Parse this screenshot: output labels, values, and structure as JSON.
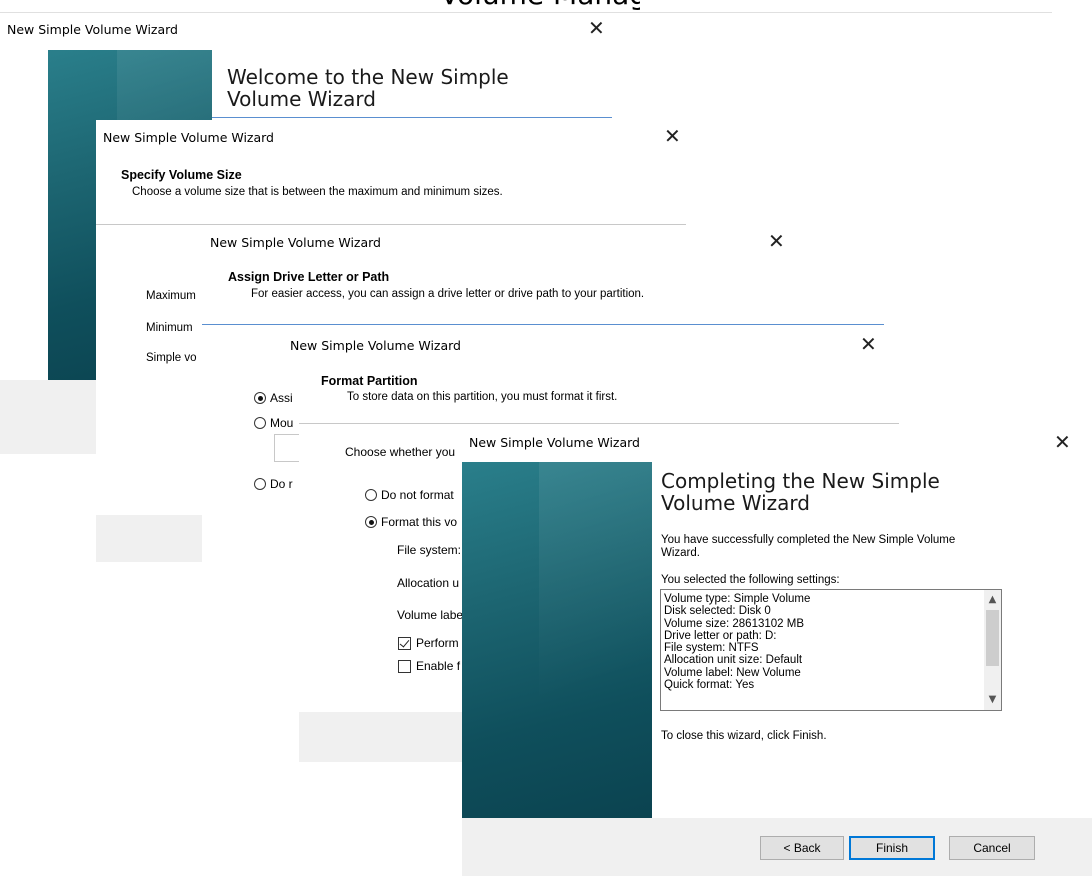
{
  "top_fragment": "Volume Management",
  "w1": {
    "title": "New Simple Volume Wizard",
    "heading_line1": "Welcome to the New Simple",
    "heading_line2": "Volume Wizard"
  },
  "w2": {
    "title": "New Simple Volume Wizard",
    "heading": "Specify Volume Size",
    "subtitle": "Choose a volume size that is between the maximum and minimum sizes.",
    "label_max": "Maximum",
    "label_min": "Minimum",
    "label_simple": "Simple vo"
  },
  "w3": {
    "title": "New Simple Volume Wizard",
    "heading": "Assign Drive Letter or Path",
    "subtitle": "For easier access, you can assign a drive letter or drive path to your partition.",
    "opt_assign": "Assi",
    "opt_mount": "Mou",
    "opt_none": "Do r"
  },
  "w4": {
    "title": "New Simple Volume Wizard",
    "heading": "Format Partition",
    "subtitle": "To store data on this partition, you must format it first.",
    "choose": "Choose whether you",
    "opt_noformat": "Do not format",
    "opt_format": "Format this vo",
    "file_system": "File system:",
    "alloc": "Allocation u",
    "vol_label": "Volume labe",
    "quick": "Perform",
    "compress": "Enable f"
  },
  "w5": {
    "title": "New Simple Volume Wizard",
    "heading_line1": "Completing the New Simple",
    "heading_line2": "Volume Wizard",
    "success_line1": "You have successfully completed the New Simple Volume",
    "success_line2": "Wizard.",
    "selected_label": "You selected the following settings:",
    "settings": [
      "Volume type: Simple Volume",
      "Disk selected: Disk 0",
      "Volume size: 28613102 MB",
      "Drive letter or path: D:",
      "File system: NTFS",
      "Allocation unit size: Default",
      "Volume label: New Volume",
      "Quick format: Yes"
    ],
    "close_text": "To close this wizard, click Finish.",
    "back": "< Back",
    "finish": "Finish",
    "cancel": "Cancel"
  },
  "icons": {
    "close": "close-icon",
    "scroll_up": "chevron-up-icon",
    "scroll_down": "chevron-down-icon"
  }
}
